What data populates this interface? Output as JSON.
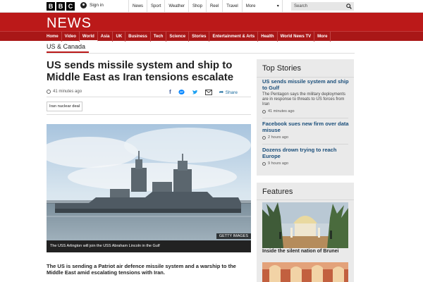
{
  "brand": {
    "letters": [
      "B",
      "B",
      "C"
    ],
    "section_title": "NEWS"
  },
  "header": {
    "signin_label": "Sign in",
    "top_links": [
      "News",
      "Sport",
      "Weather",
      "Shop",
      "Reel",
      "Travel",
      "More"
    ],
    "search_placeholder": "Search"
  },
  "main_nav": [
    "Home",
    "Video",
    "World",
    "Asia",
    "UK",
    "Business",
    "Tech",
    "Science",
    "Stories",
    "Entertainment & Arts",
    "Health",
    "World News TV",
    "More"
  ],
  "section": "US & Canada",
  "article": {
    "headline": "US sends missile system and ship to Middle East as Iran tensions escalate",
    "timestamp": "41 minutes ago",
    "share_label": "Share",
    "tag": "Iran nuclear deal",
    "image_credit": "GETTY IMAGES",
    "caption": "The USS Arlington will join the USS Abraham Lincoln in the Gulf",
    "lead": "The US is sending a Patriot air defence missile system and a warship to the Middle East amid escalating tensions with Iran."
  },
  "top_stories": {
    "title": "Top Stories",
    "items": [
      {
        "headline": "US sends missile system and ship to Gulf",
        "summary": "The Pentagon says the military deployments are in response to threats to US forces from Iran",
        "time": "41 minutes ago"
      },
      {
        "headline": "Facebook sues new firm over data misuse",
        "time": "2 hours ago"
      },
      {
        "headline": "Dozens drown trying to reach Europe",
        "time": "9 hours ago"
      }
    ]
  },
  "features": {
    "title": "Features",
    "items": [
      {
        "caption": "Inside the silent nation of Brunei"
      }
    ]
  },
  "colors": {
    "brand_red": "#bb1919",
    "nav_red": "#a91717",
    "link_blue": "#1a4e7a"
  }
}
